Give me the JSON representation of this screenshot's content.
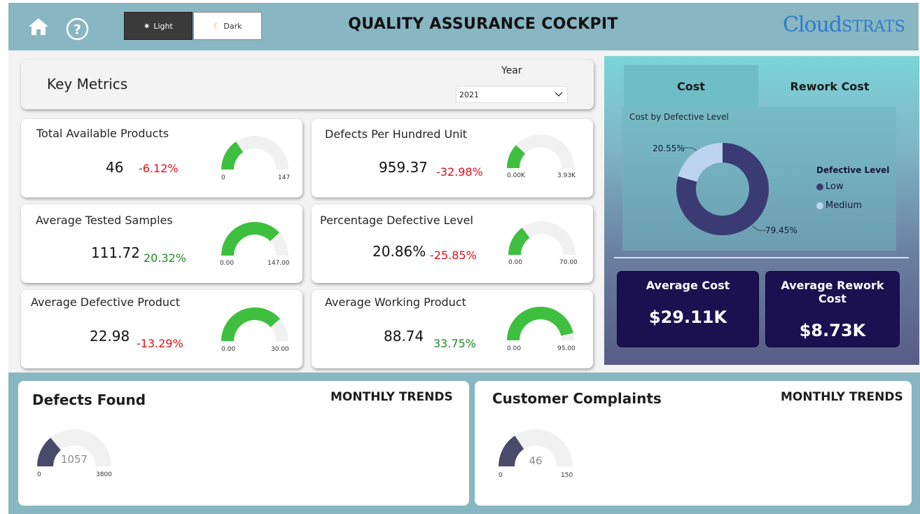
{
  "header": {
    "title": "QUALITY ASSURANCE COCKPIT",
    "brand_logo": "Cloudstrats",
    "home_icon": "home-icon",
    "help_icon": "help-icon",
    "theme_light_label": "Light",
    "theme_dark_label": "Dark",
    "bar_color": "#88b6c3"
  },
  "key_metrics": {
    "title": "Key Metrics",
    "year_label": "Year",
    "year_value": "2021"
  },
  "metrics": [
    {
      "title": "Total Available Products",
      "value": "46",
      "delta": "-6.12%",
      "gauge_min": "0",
      "gauge_max": "147",
      "fill_fraction": 0.31
    },
    {
      "title": "Defects Per Hundred Unit",
      "value": "959.37",
      "delta": "-32.98%",
      "gauge_min": "0.00K",
      "gauge_max": "3.93K",
      "fill_fraction": 0.24
    },
    {
      "title": "Average Tested Samples",
      "value": "111.72",
      "delta": "20.32%",
      "gauge_min": "0.00",
      "gauge_max": "147.00",
      "fill_fraction": 0.76
    },
    {
      "title": "Percentage Defective Level",
      "value": "20.86%",
      "delta": "-25.85%",
      "gauge_min": "0.00",
      "gauge_max": "70.00",
      "fill_fraction": 0.3
    },
    {
      "title": "Average Defective Product",
      "value": "22.98",
      "delta": "-13.29%",
      "gauge_min": "0.00",
      "gauge_max": "30.00",
      "fill_fraction": 0.77
    },
    {
      "title": "Average Working Product",
      "value": "88.74",
      "delta": "33.75%",
      "gauge_min": "0.00",
      "gauge_max": "95.00",
      "fill_fraction": 0.93
    }
  ],
  "cost_panel": {
    "tab_cost": "Cost",
    "tab_rework": "Rework Cost",
    "active_tab": "Cost",
    "donut_title": "Cost by Defective Level",
    "legend_title": "Defective Level",
    "legend": [
      {
        "label": "Low",
        "color": "#3b3b73"
      },
      {
        "label": "Medium",
        "color": "#bcd4f0"
      }
    ],
    "slices": [
      {
        "label": "79.45%",
        "value": 79.45,
        "color": "#3b3b73"
      },
      {
        "label": "20.55%",
        "value": 20.55,
        "color": "#bcd4f0"
      }
    ],
    "avg_cost_title": "Average Cost",
    "avg_cost_value": "$29.11K",
    "avg_rework_title": "Average Rework Cost",
    "avg_rework_value": "$8.73K"
  },
  "bottom": {
    "defects": {
      "title": "Defects Found",
      "trend_label": "MONTHLY TRENDS",
      "value": "1057",
      "min": "0",
      "max": "3800",
      "fill_fraction": 0.28
    },
    "complaints": {
      "title": "Customer Complaints",
      "trend_label": "MONTHLY TRENDS",
      "value": "46",
      "min": "0",
      "max": "150",
      "fill_fraction": 0.31
    }
  },
  "colors": {
    "gauge_fill": "#3fbf3f",
    "gauge_track": "#f1f1f1",
    "bottom_gauge_fill": "#4a4a6a",
    "kpi_card": "#1b1150",
    "negative": "#e0101a",
    "positive": "#218a2a"
  }
}
